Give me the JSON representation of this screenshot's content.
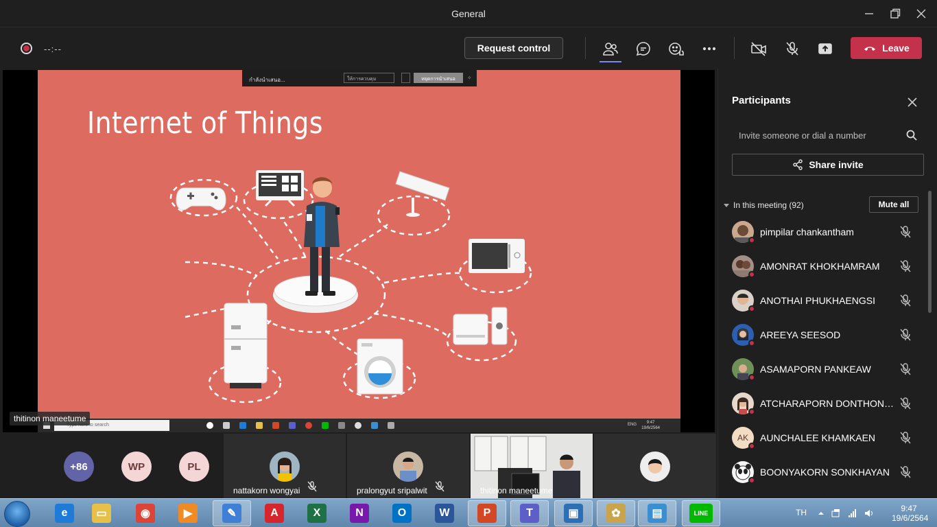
{
  "window": {
    "title": "General"
  },
  "toolbar": {
    "timer": "--:--",
    "request_control_label": "Request control",
    "leave_label": "Leave",
    "accent_color": "#c4314b"
  },
  "share": {
    "slide_title": "Internet of Things",
    "sharing_bar_text": "กำลังนำเสนอ...",
    "sharing_bar_select": "ให้การควบคุม",
    "sharing_bar_stop": "หยุดการนำเสนอ",
    "presenter_label": "thitinon maneetume",
    "inner_taskbar_search": "Type here to search",
    "inner_clock_time": "9:47",
    "inner_clock_date": "19/6/2564",
    "inner_lang": "ENG"
  },
  "participants": {
    "title": "Participants",
    "invite_placeholder": "Invite someone or dial a number",
    "share_invite_label": "Share invite",
    "in_meeting_label": "In this meeting (92)",
    "mute_all_label": "Mute all",
    "list": [
      {
        "name": "pimpilar chankantham",
        "avatar": "photo"
      },
      {
        "name": "AMONRAT KHOKHAMRAM",
        "avatar": "photo"
      },
      {
        "name": "ANOTHAI PHUKHAENGSI",
        "avatar": "photo"
      },
      {
        "name": "AREEYA SEESOD",
        "avatar": "photo"
      },
      {
        "name": "ASAMAPORN PANKEAW",
        "avatar": "photo"
      },
      {
        "name": "ATCHARAPORN DONTHONG...",
        "avatar": "photo"
      },
      {
        "name": "AUNCHALEE KHAMKAEN",
        "avatar": "AK"
      },
      {
        "name": "BOONYAKORN SONKHAYAN",
        "avatar": "photo"
      }
    ]
  },
  "gallery": {
    "overflow": [
      {
        "label": "+86",
        "bg": "#6264a7",
        "fg": "#ffffff"
      },
      {
        "label": "WP",
        "bg": "#f4d6d6",
        "fg": "#6b3b3b"
      },
      {
        "label": "PL",
        "bg": "#f4d6d6",
        "fg": "#6b3b3b"
      }
    ],
    "tiles": [
      {
        "name": "nattakorn wongyai"
      },
      {
        "name": "pralongyut sripalwit"
      },
      {
        "name": "thitinon maneetume"
      },
      {
        "name": ""
      }
    ]
  },
  "taskbar": {
    "apps": [
      {
        "icon": "ie-icon",
        "glyph": "e",
        "color": "#1e7bd8"
      },
      {
        "icon": "file-explorer-icon",
        "glyph": "▭",
        "color": "#e7c04a"
      },
      {
        "icon": "chrome-icon",
        "glyph": "◉",
        "color": "#db4437"
      },
      {
        "icon": "media-player-icon",
        "glyph": "▶",
        "color": "#f08a24"
      },
      {
        "icon": "sticky-app-icon",
        "glyph": "✎",
        "color": "#3f7fd6"
      },
      {
        "icon": "acrobat-icon",
        "glyph": "A",
        "color": "#d6262b"
      },
      {
        "icon": "excel-icon",
        "glyph": "X",
        "color": "#1e7145"
      },
      {
        "icon": "onenote-icon",
        "glyph": "N",
        "color": "#7719aa"
      },
      {
        "icon": "outlook-icon",
        "glyph": "O",
        "color": "#0072c6"
      },
      {
        "icon": "word-icon",
        "glyph": "W",
        "color": "#2b579a"
      },
      {
        "icon": "powerpoint-icon",
        "glyph": "P",
        "color": "#d24726"
      },
      {
        "icon": "teams-icon",
        "glyph": "T",
        "color": "#5b5fc7"
      },
      {
        "icon": "remote-desktop-icon",
        "glyph": "▣",
        "color": "#2d6fb5"
      },
      {
        "icon": "paint-icon",
        "glyph": "✿",
        "color": "#c9a44a"
      },
      {
        "icon": "photo-viewer-icon",
        "glyph": "▤",
        "color": "#3a8fd0"
      },
      {
        "icon": "line-icon",
        "glyph": "LINE",
        "color": "#00b900"
      }
    ],
    "lang": "TH",
    "clock_time": "9:47",
    "clock_date": "19/6/2564"
  }
}
